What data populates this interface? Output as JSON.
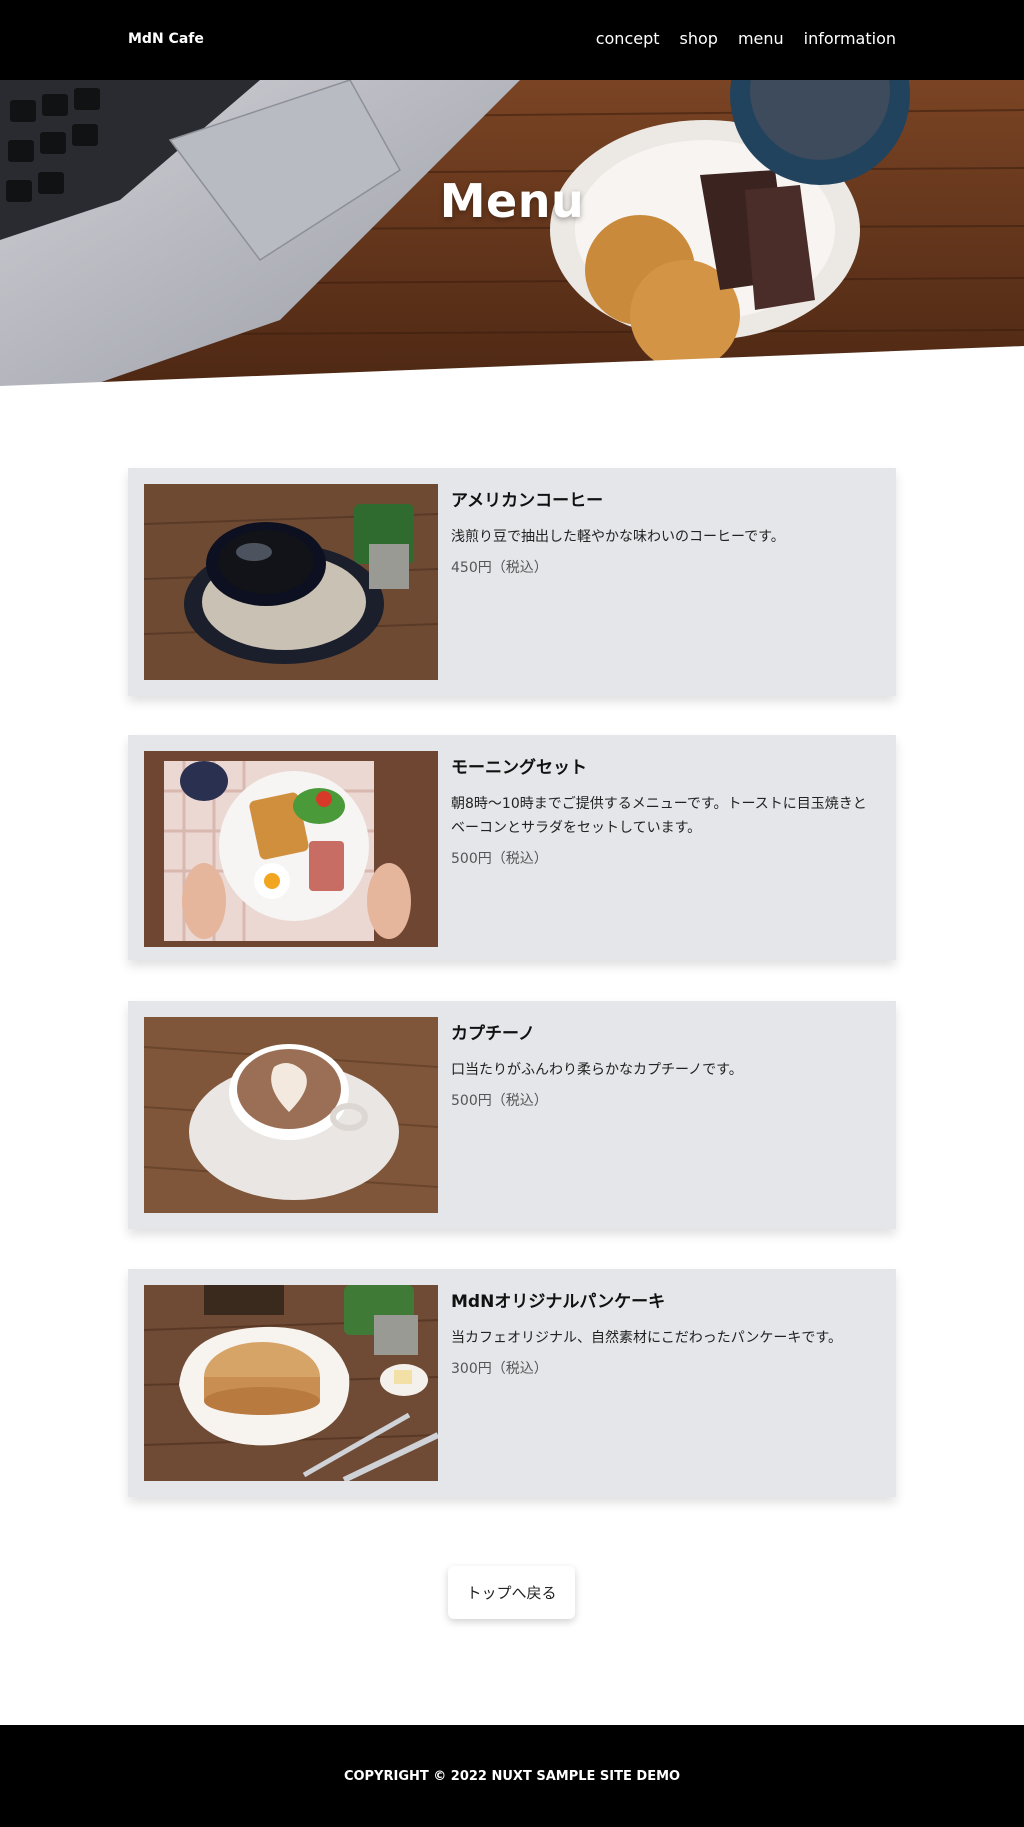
{
  "header": {
    "logo": "MdN Cafe",
    "nav": [
      "concept",
      "shop",
      "menu",
      "information"
    ]
  },
  "hero": {
    "title": "Menu"
  },
  "menu": {
    "items": [
      {
        "name": "アメリカンコーヒー",
        "description": "浅煎り豆で抽出した軽やかな味わいのコーヒーです。",
        "price": "450円（税込）",
        "image": "coffee-cup-image"
      },
      {
        "name": "モーニングセット",
        "description": "朝8時〜10時までご提供するメニューです。トーストに目玉焼きとベーコンとサラダをセットしています。",
        "price": "500円（税込）",
        "image": "breakfast-plate-image"
      },
      {
        "name": "カプチーノ",
        "description": "口当たりがふんわり柔らかなカプチーノです。",
        "price": "500円（税込）",
        "image": "cappuccino-image"
      },
      {
        "name": "MdNオリジナルパンケーキ",
        "description": "当カフェオリジナル、自然素材にこだわったパンケーキです。",
        "price": "300円（税込）",
        "image": "pancake-image"
      }
    ]
  },
  "back_button": "トップへ戻る",
  "footer": {
    "copyright": "COPYRIGHT © 2022 NUXT SAMPLE SITE DEMO"
  },
  "colors": {
    "header_bg": "#000000",
    "card_bg": "#e5e6ea",
    "footer_bg": "#000000",
    "wood": "#6b3a1f"
  }
}
